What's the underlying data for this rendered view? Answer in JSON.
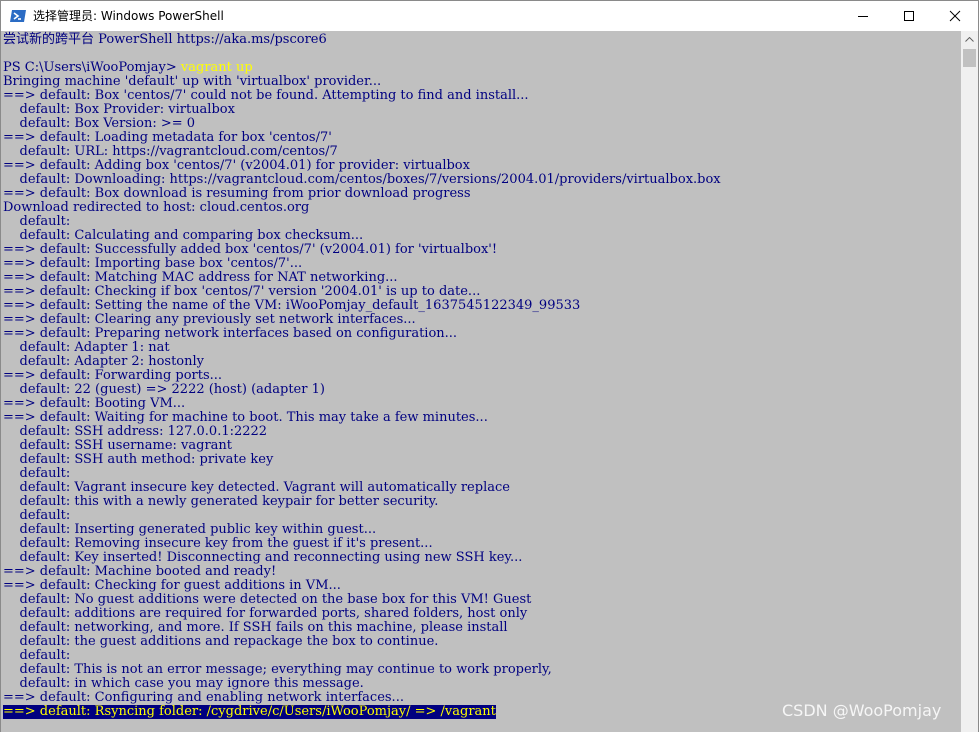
{
  "window": {
    "title": "选择管理员: Windows PowerShell",
    "minimize_icon": "minimize-icon",
    "maximize_icon": "maximize-icon",
    "close_icon": "close-icon",
    "app_icon": "powershell-icon"
  },
  "console": {
    "background": "#c0c0c0",
    "text_color": "#000080",
    "command_color": "#ffff00",
    "header": "尝试新的跨平台 PowerShell https://aka.ms/pscore6",
    "prompt": "PS C:\\Users\\iWooPomjay> ",
    "command": "vagrant up",
    "lines": [
      "Bringing machine 'default' up with 'virtualbox' provider...",
      "==> default: Box 'centos/7' could not be found. Attempting to find and install...",
      "    default: Box Provider: virtualbox",
      "    default: Box Version: >= 0",
      "==> default: Loading metadata for box 'centos/7'",
      "    default: URL: https://vagrantcloud.com/centos/7",
      "==> default: Adding box 'centos/7' (v2004.01) for provider: virtualbox",
      "    default: Downloading: https://vagrantcloud.com/centos/boxes/7/versions/2004.01/providers/virtualbox.box",
      "==> default: Box download is resuming from prior download progress",
      "Download redirected to host: cloud.centos.org",
      "    default:",
      "    default: Calculating and comparing box checksum...",
      "==> default: Successfully added box 'centos/7' (v2004.01) for 'virtualbox'!",
      "==> default: Importing base box 'centos/7'...",
      "==> default: Matching MAC address for NAT networking...",
      "==> default: Checking if box 'centos/7' version '2004.01' is up to date...",
      "==> default: Setting the name of the VM: iWooPomjay_default_1637545122349_99533",
      "==> default: Clearing any previously set network interfaces...",
      "==> default: Preparing network interfaces based on configuration...",
      "    default: Adapter 1: nat",
      "    default: Adapter 2: hostonly",
      "==> default: Forwarding ports...",
      "    default: 22 (guest) => 2222 (host) (adapter 1)",
      "==> default: Booting VM...",
      "==> default: Waiting for machine to boot. This may take a few minutes...",
      "    default: SSH address: 127.0.0.1:2222",
      "    default: SSH username: vagrant",
      "    default: SSH auth method: private key",
      "    default:",
      "    default: Vagrant insecure key detected. Vagrant will automatically replace",
      "    default: this with a newly generated keypair for better security.",
      "    default:",
      "    default: Inserting generated public key within guest...",
      "    default: Removing insecure key from the guest if it's present...",
      "    default: Key inserted! Disconnecting and reconnecting using new SSH key...",
      "==> default: Machine booted and ready!",
      "==> default: Checking for guest additions in VM...",
      "    default: No guest additions were detected on the base box for this VM! Guest",
      "    default: additions are required for forwarded ports, shared folders, host only",
      "    default: networking, and more. If SSH fails on this machine, please install",
      "    default: the guest additions and repackage the box to continue.",
      "    default:",
      "    default: This is not an error message; everything may continue to work properly,",
      "    default: in which case you may ignore this message.",
      "==> default: Configuring and enabling network interfaces..."
    ],
    "current_line": "==> default: Rsyncing folder: /cygdrive/c/Users/iWooPomjay/ => /vagrant"
  },
  "watermark": "CSDN @WooPomjay"
}
